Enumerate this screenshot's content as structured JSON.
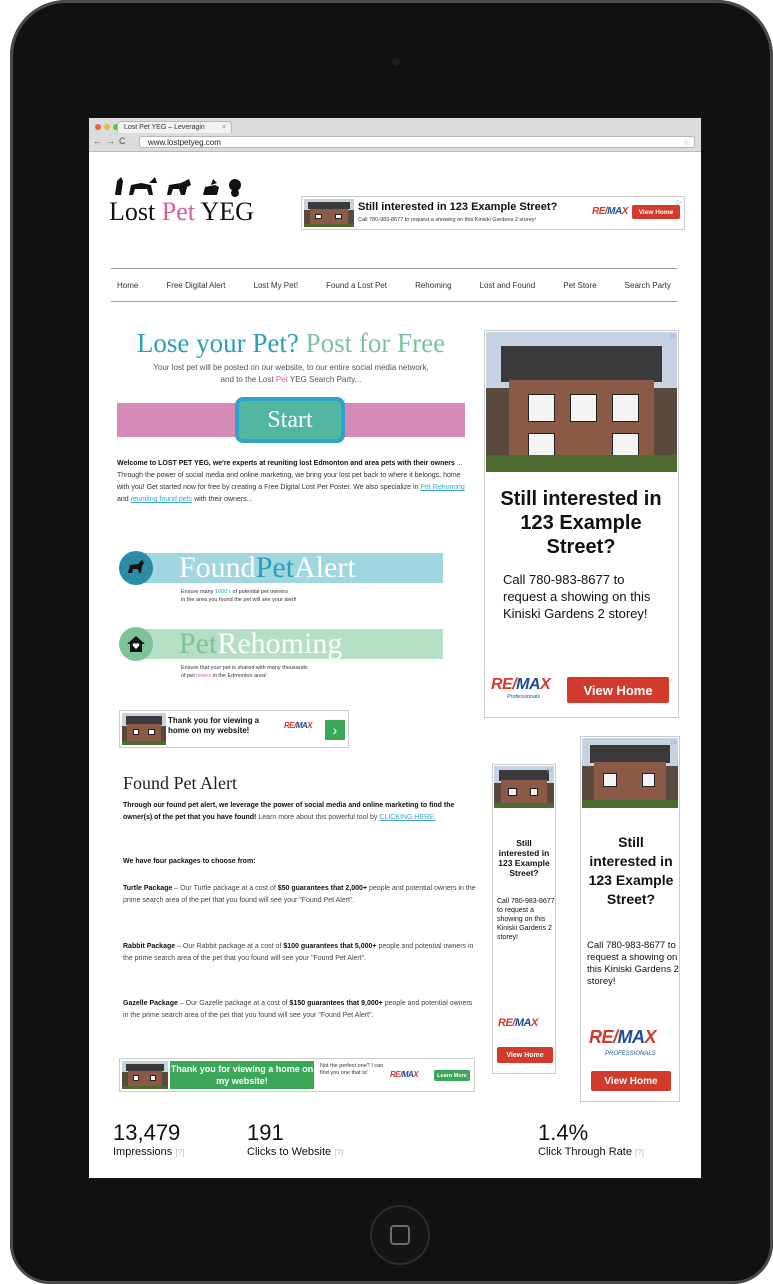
{
  "browser": {
    "tab_title": "Lost Pet YEG – Leveragin",
    "tab_close": "×",
    "back": "←",
    "forward": "→",
    "reload": "C",
    "url": "www.lostpetyeg.com",
    "star": "☆"
  },
  "logo": {
    "part1": "Lost ",
    "part2": "Pet",
    "part3": " YEG"
  },
  "leaderboard_ad": {
    "headline": "Still interested in 123 Example Street?",
    "body": "Call 780-983-8677 to request a showing on this Kiniski Gardens 2 storey!",
    "brand_left": "RE/",
    "brand_mid": "MA",
    "brand_right": "X",
    "button": "View Home",
    "adchoices": "▷"
  },
  "nav": {
    "items": [
      "Home",
      "Free Digital Alert",
      "Lost My Pet!",
      "Found a Lost Pet",
      "Rehoming",
      "Lost and Found",
      "Pet Store",
      "Search Party"
    ]
  },
  "hero": {
    "headline_a": "Lose your Pet?",
    "headline_b": "Post for Free",
    "sub_a": "Your lost pet will be posted on our website, to our entire social media network,",
    "sub_b": "and to the Lost",
    "sub_pet": "Pet",
    "sub_c": "YEG Search Party...",
    "start": "Start"
  },
  "welcome": {
    "bold": "Welcome to LOST PET YEG, we're experts at reuniting lost Edmonton and area pets with their owners",
    "text": "... Through the power of social media and online marketing, we bring your lost pet back to where it belongs, home with you! Get started now for free by creating a Free Digital Lost Pet Poster.  We also specialize in",
    "link1": "Pet Rehoming",
    "and": "and",
    "link2": "reuniting found pets",
    "end": "with their owners..."
  },
  "found_banner": {
    "word1": "Found",
    "word2": "Pet",
    "word3": "Alert",
    "desc_a": "Ensure many",
    "desc_hl": "1000's",
    "desc_b": "of potential pet owners",
    "desc_c": "in the area you found the pet will see your alert!"
  },
  "rehome_banner": {
    "word1": "Pet",
    "word2": "Rehoming",
    "desc_a": "Ensure that your pet is shared with many thousands",
    "desc_b": "of pet",
    "desc_pk": "lovers",
    "desc_c": "in the Edmonton area!"
  },
  "thanks_ad": {
    "text": "Thank you for viewing a home on my website!",
    "arrow": "›"
  },
  "found_section": {
    "title": "Found Pet Alert",
    "intro_bold": "Through our found pet alert, we leverage the power of social media and online marketing to find the owner(s) of the pet that you have found!",
    "intro_text": "Learn more about this powerful tool by",
    "intro_link": "CLICKING HERE.",
    "packages_heading": "We have four packages to choose from:",
    "packages": [
      {
        "name": "Turtle Package",
        "a": " – Our Turtle package at a cost of ",
        "price": "$50 guarantees that 2,000+",
        "b": " people and potential owners in the prime search area of the pet that you found will see your \"Found Pet Alert\"."
      },
      {
        "name": "Rabbit Package",
        "a": " – Our Rabbit package at a cost of ",
        "price": "$100 guarantees that 5,000+",
        "b": " people and potential owners in the prime search area of the pet that you found will see your \"Found Pet Alert\"."
      },
      {
        "name": "Gazelle Package",
        "a": " – Our Gazelle package at a cost of ",
        "price": "$150 guarantees that 9,000+",
        "b": " people and potential owners in the prime search area of the pet that you found will see your \"Found Pet Alert\"."
      }
    ]
  },
  "bottom_ad": {
    "text": "Thank you for viewing a home on my website!",
    "aside": "Not the perfect one? I can find you one that is!",
    "button": "Learn More"
  },
  "side_ad_large": {
    "headline": "Still interested in 123 Example Street?",
    "body": "Call 780-983-8677 to request a showing on this Kiniski Gardens 2 storey!",
    "button": "View Home",
    "sub_brand": "Professionals"
  },
  "side_ad_narrow": {
    "headline": "Still interested in 123 Example Street?",
    "body": "Call 780-983-8677 to request a showing on this Kiniski Gardens 2 storey!",
    "button": "View Home"
  },
  "side_ad_medium": {
    "headline": "Still interested in 123 Example Street?",
    "body": "Call 780-983-8677 to request a showing on this Kiniski Gardens 2 storey!",
    "button": "View Home",
    "sub_brand": "PROFESSIONALS"
  },
  "stats": [
    {
      "value": "13,479",
      "label": "Impressions",
      "help": "[?]"
    },
    {
      "value": "191",
      "label": "Clicks to Website",
      "help": "[?]"
    },
    {
      "value": "1.4%",
      "label": "Click Through Rate",
      "help": "[?]"
    }
  ],
  "colors": {
    "teal": "#2a9fb7",
    "mint": "#7cc39a",
    "pink": "#d55ea0",
    "remax_red": "#d23a2b",
    "remax_blue": "#1f4b9c"
  }
}
